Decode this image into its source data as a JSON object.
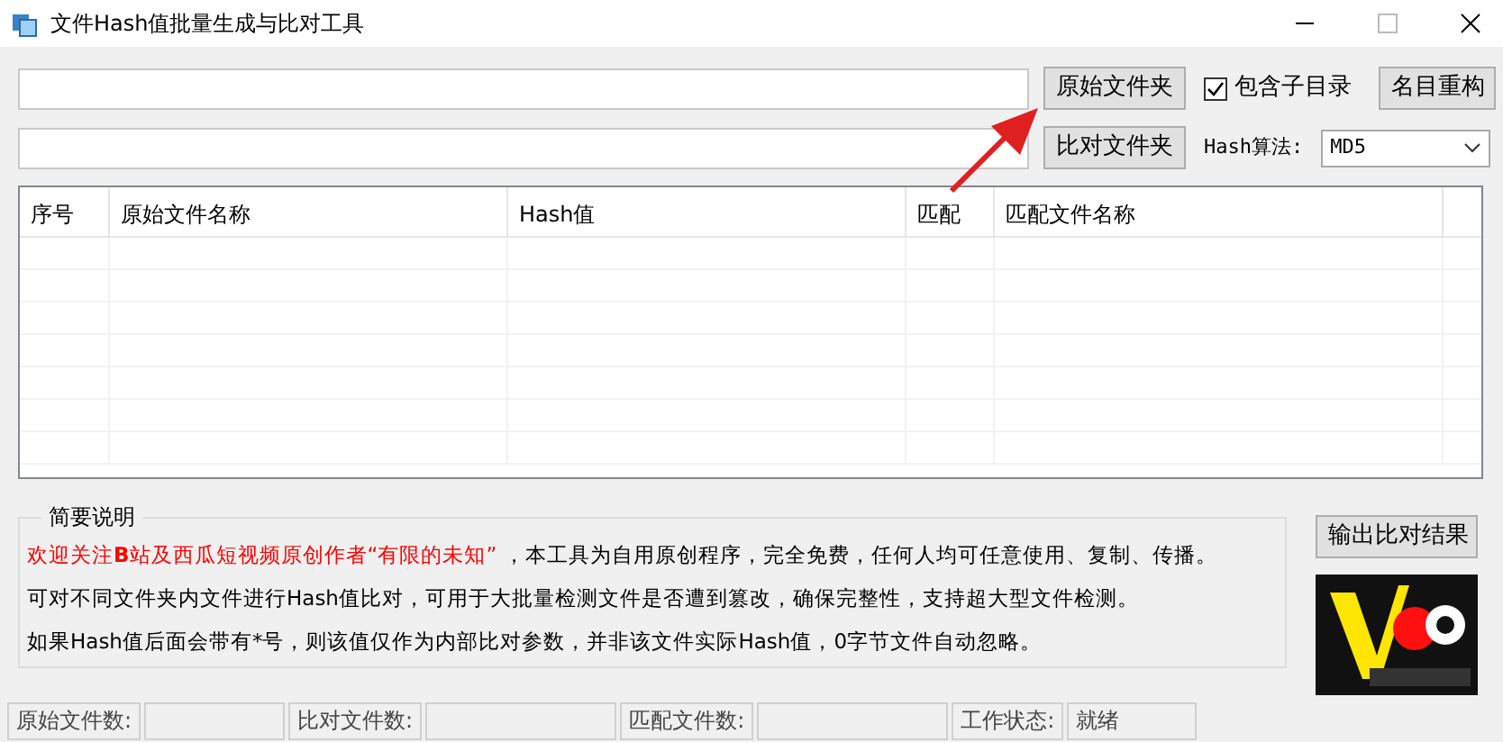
{
  "window": {
    "title": "文件Hash值批量生成与比对工具"
  },
  "source_button": "原始文件夹",
  "compare_button": "比对文件夹",
  "include_subdirs": {
    "label": "包含子目录",
    "checked": true
  },
  "rename_button": "名目重构",
  "hash_algorithm": {
    "label": "Hash算法:",
    "value": "MD5"
  },
  "table": {
    "columns": [
      "序号",
      "原始文件名称",
      "Hash值",
      "匹配",
      "匹配文件名称"
    ]
  },
  "description": {
    "title": "简要说明",
    "highlight": "欢迎关注**B**站及西瓜短视频原创作者“有限的未知”",
    "lines": [
      "，本工具为自用原创程序，完全免费，任何人均可任意使用、复制、传播。",
      "可对不同文件夹内文件进行Hash值比对，可用于大批量检测文件是否遭到篡改，确保完整性，支持超大型文件检测。",
      "如果Hash值后面会带有*号，则该值仅作为内部比对参数，并非该文件实际Hash值，0字节文件自动忽略。"
    ]
  },
  "export_button": "输出比对结果",
  "status_bar": [
    {
      "label": "原始文件数:"
    },
    {
      "label": "比对文件数:"
    },
    {
      "label": "匹配文件数:"
    },
    {
      "label": "工作状态:",
      "value": "就绪"
    }
  ]
}
